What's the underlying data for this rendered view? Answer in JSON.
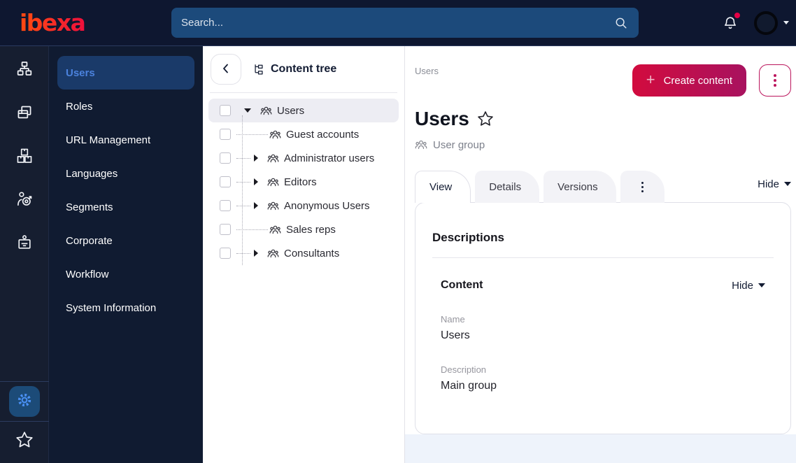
{
  "topbar": {
    "logo": "ibexa",
    "search_placeholder": "Search..."
  },
  "sidebar": {
    "items": [
      {
        "label": "Users",
        "active": true
      },
      {
        "label": "Roles"
      },
      {
        "label": "URL Management"
      },
      {
        "label": "Languages"
      },
      {
        "label": "Segments"
      },
      {
        "label": "Corporate"
      },
      {
        "label": "Workflow"
      },
      {
        "label": "System Information"
      }
    ]
  },
  "content_tree": {
    "title": "Content tree",
    "items": [
      {
        "label": "Users",
        "state": "expanded",
        "selected": true
      },
      {
        "label": "Guest accounts",
        "state": "leaf"
      },
      {
        "label": "Administrator users",
        "state": "collapsed"
      },
      {
        "label": "Editors",
        "state": "collapsed"
      },
      {
        "label": "Anonymous Users",
        "state": "collapsed"
      },
      {
        "label": "Sales reps",
        "state": "leaf"
      },
      {
        "label": "Consultants",
        "state": "collapsed"
      }
    ]
  },
  "main": {
    "breadcrumb": "Users",
    "create_button": "Create content",
    "title": "Users",
    "content_type": "User group",
    "tabs": [
      {
        "label": "View",
        "active": true
      },
      {
        "label": "Details"
      },
      {
        "label": "Versions"
      }
    ],
    "hide_label": "Hide",
    "card": {
      "heading": "Descriptions",
      "section_title": "Content",
      "section_hide": "Hide",
      "fields": [
        {
          "label": "Name",
          "value": "Users"
        },
        {
          "label": "Description",
          "value": "Main group"
        }
      ]
    }
  },
  "colors": {
    "topbar_bg": "#0e1730",
    "search_bg": "#1c4a7b",
    "sidebar_active_bg": "#1a3a69",
    "sidebar_active_text": "#4b82dd",
    "brand_gradient_start": "#d20b3e",
    "brand_gradient_end": "#a8125f",
    "notification_badge": "#e40045",
    "settings_icon_blue": "#4a90f4"
  }
}
